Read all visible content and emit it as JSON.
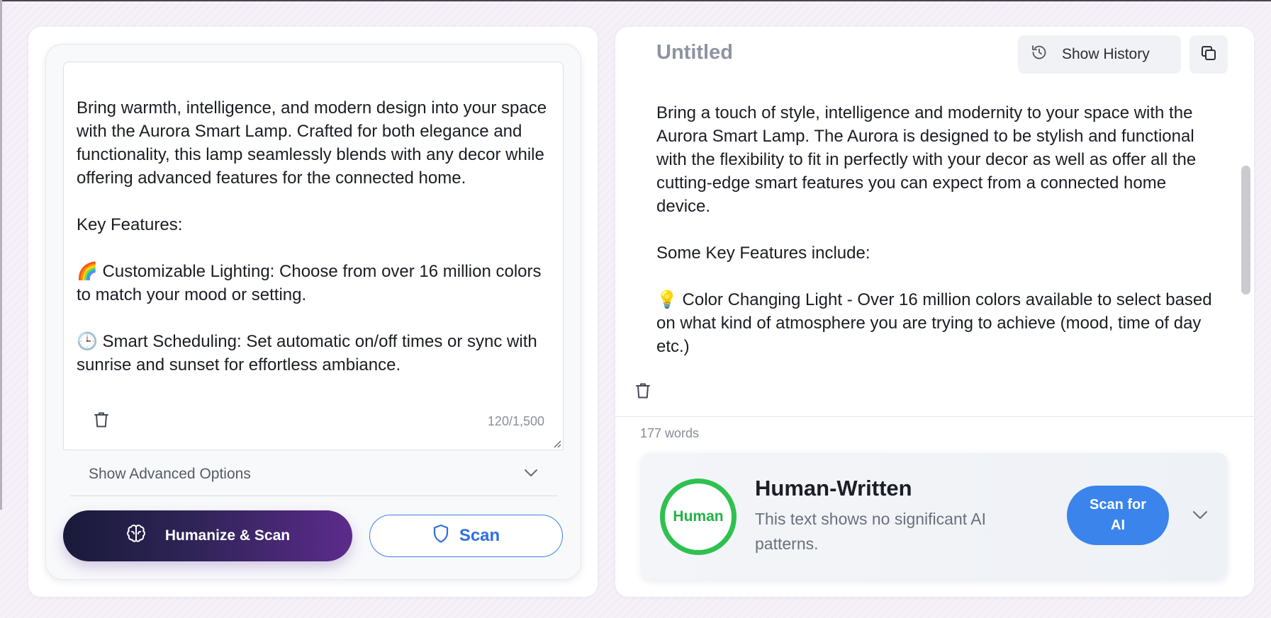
{
  "colors": {
    "accent_blue": "#3a84ec",
    "scan_border": "#3f7ee8",
    "human_green": "#2ec14f",
    "humanize_gradient_start": "#191a3a",
    "humanize_gradient_end": "#5c2b8c"
  },
  "input_panel": {
    "text": "Bring warmth, intelligence, and modern design into your space with the Aurora Smart Lamp. Crafted for both elegance and functionality, this lamp seamlessly blends with any decor while offering advanced features for the connected home.\n\nKey Features:\n\n🌈 Customizable Lighting: Choose from over 16 million colors to match your mood or setting.\n\n🕒 Smart Scheduling: Set automatic on/off times or sync with sunrise and sunset for effortless ambiance.",
    "counter": "120/1,500",
    "advanced_options_label": "Show Advanced Options",
    "humanize_label": "Humanize & Scan",
    "scan_label": "Scan",
    "icons": {
      "trash": "trash-icon",
      "chevron": "chevron-down-icon",
      "brain": "brain-icon",
      "shield": "shield-icon"
    }
  },
  "output_panel": {
    "title": "Untitled",
    "history_label": "Show History",
    "text": "Bring a touch of style, intelligence and modernity to your space with the Aurora Smart Lamp. The Aurora is designed to be stylish and functional with the flexibility to fit in perfectly with your decor as well as offer all the cutting-edge smart features you can expect from a connected home device.\n\nSome Key Features include:\n\n💡 Color Changing Light - Over 16 million colors available to select based on what kind of atmosphere you are trying to achieve (mood, time of day etc.)",
    "word_count": "177 words",
    "icons": {
      "history": "history-icon",
      "copy": "copy-icon",
      "trash": "trash-icon"
    }
  },
  "result": {
    "badge": "Human",
    "title": "Human-Written",
    "description": "This text shows no significant AI patterns.",
    "scan_ai_label": "Scan for AI"
  }
}
